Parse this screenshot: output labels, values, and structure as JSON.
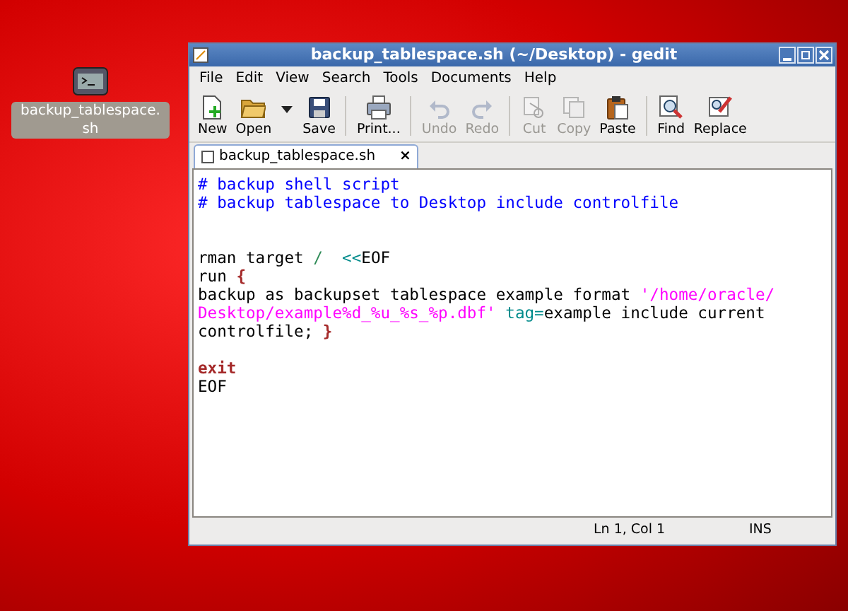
{
  "desktop_icon": {
    "label": "backup_tablespace.sh"
  },
  "window": {
    "title": "backup_tablespace.sh (~/Desktop) - gedit"
  },
  "menu": [
    "File",
    "Edit",
    "View",
    "Search",
    "Tools",
    "Documents",
    "Help"
  ],
  "toolbar": [
    {
      "kind": "button",
      "label": "New",
      "disabled": false
    },
    {
      "kind": "button",
      "label": "Open",
      "disabled": false
    },
    {
      "kind": "dropdown"
    },
    {
      "kind": "button",
      "label": "Save",
      "disabled": false
    },
    {
      "kind": "separator"
    },
    {
      "kind": "button",
      "label": "Print...",
      "disabled": false
    },
    {
      "kind": "separator"
    },
    {
      "kind": "button",
      "label": "Undo",
      "disabled": true
    },
    {
      "kind": "button",
      "label": "Redo",
      "disabled": true
    },
    {
      "kind": "separator"
    },
    {
      "kind": "button",
      "label": "Cut",
      "disabled": true
    },
    {
      "kind": "button",
      "label": "Copy",
      "disabled": true
    },
    {
      "kind": "button",
      "label": "Paste",
      "disabled": false
    },
    {
      "kind": "separator"
    },
    {
      "kind": "button",
      "label": "Find",
      "disabled": false
    },
    {
      "kind": "button",
      "label": "Replace",
      "disabled": false
    }
  ],
  "tabs": [
    {
      "label": "backup_tablespace.sh",
      "close": "×",
      "selected": true
    }
  ],
  "editor": {
    "lines": [
      {
        "kind": "code",
        "segments": [
          {
            "kind": "comment",
            "text": "# backup shell script"
          }
        ]
      },
      {
        "kind": "code",
        "segments": [
          {
            "kind": "comment",
            "text": "# backup tablespace to Desktop include controlfile"
          }
        ]
      },
      {
        "kind": "blank"
      },
      {
        "kind": "blank"
      },
      {
        "kind": "code",
        "segments": [
          {
            "kind": "plain",
            "text": "rman target "
          },
          {
            "kind": "operator",
            "text": "/"
          },
          {
            "kind": "redirect",
            "text": "  <<"
          },
          {
            "kind": "plain",
            "text": "EOF"
          }
        ]
      },
      {
        "kind": "code",
        "segments": [
          {
            "kind": "plain",
            "text": "run "
          },
          {
            "kind": "keyword",
            "text": "{"
          }
        ]
      },
      {
        "kind": "code",
        "segments": [
          {
            "kind": "plain",
            "text": "backup as backupset tablespace example format "
          },
          {
            "kind": "string",
            "text": "'/home/oracle/"
          }
        ]
      },
      {
        "kind": "code",
        "segments": [
          {
            "kind": "string",
            "text": "Desktop/example%d_%u_%s_%p.dbf'"
          },
          {
            "kind": "redirect",
            "text": " tag="
          },
          {
            "kind": "plain",
            "text": "example include current"
          }
        ]
      },
      {
        "kind": "code",
        "segments": [
          {
            "kind": "plain",
            "text": "controlfile; "
          },
          {
            "kind": "keyword",
            "text": "}"
          }
        ]
      },
      {
        "kind": "blank"
      },
      {
        "kind": "code",
        "segments": [
          {
            "kind": "keyword",
            "text": "exit"
          }
        ]
      },
      {
        "kind": "code",
        "segments": [
          {
            "kind": "plain",
            "text": "EOF"
          }
        ]
      }
    ]
  },
  "status_bar": {
    "position": "Ln 1, Col 1",
    "mode": "INS"
  }
}
